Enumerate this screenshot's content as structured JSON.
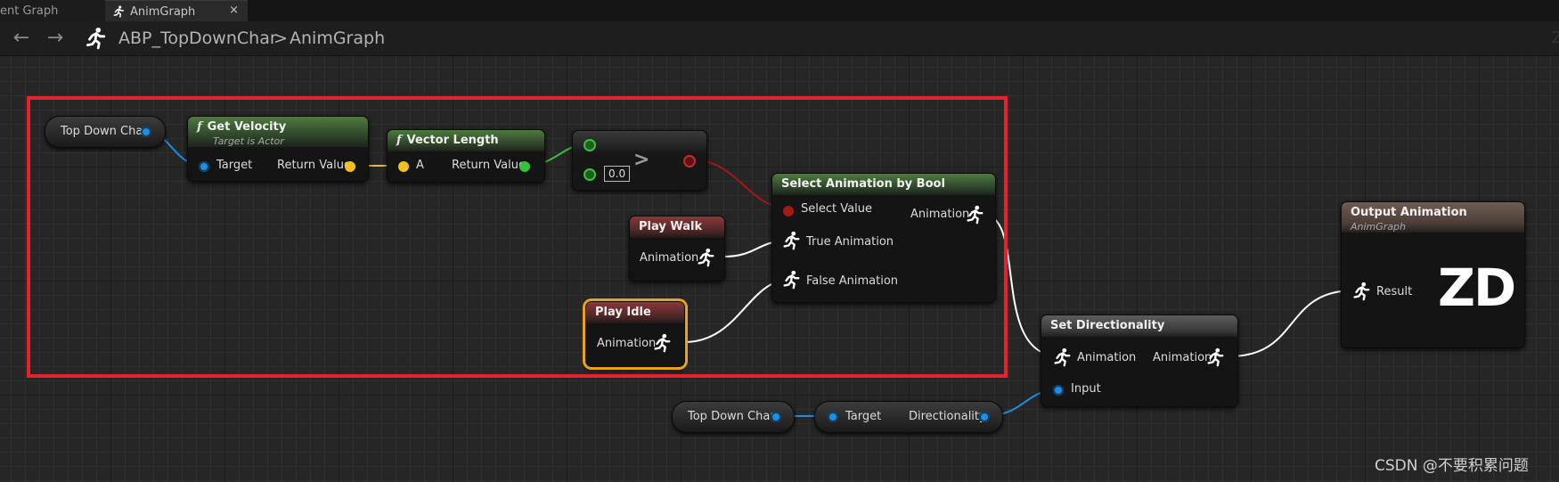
{
  "tabs": {
    "event_graph": "ent Graph",
    "anim_graph": "AnimGraph",
    "close": "×"
  },
  "breadcrumb": {
    "back": "←",
    "forward": "→",
    "blueprint": "ABP_TopDownChar",
    "separator": ">",
    "graph": "AnimGraph",
    "edge": "Z"
  },
  "nodes": {
    "top_down_char_1": {
      "label": "Top Down Char"
    },
    "get_velocity": {
      "title": "Get Velocity",
      "subtitle": "Target is Actor",
      "in_pin": "Target",
      "out_pin": "Return Value",
      "fn_icon": "f"
    },
    "vector_length": {
      "title": "Vector Length",
      "in_pin": "A",
      "out_pin": "Return Value",
      "fn_icon": "f"
    },
    "greater": {
      "symbol": ">",
      "const_value": "0.0"
    },
    "select_anim": {
      "title": "Select Animation by Bool",
      "select_pin": "Select Value",
      "true_pin": "True Animation",
      "false_pin": "False Animation",
      "out_pin": "Animation"
    },
    "play_walk": {
      "title": "Play Walk",
      "out_pin": "Animation"
    },
    "play_idle": {
      "title": "Play Idle",
      "out_pin": "Animation"
    },
    "set_directionality": {
      "title": "Set Directionality",
      "in_anim": "Animation",
      "out_anim": "Animation",
      "in_input": "Input"
    },
    "output_animation": {
      "title": "Output Animation",
      "subtitle": "AnimGraph",
      "in_pin": "Result",
      "logo": "ZD"
    },
    "top_down_char_2": {
      "label": "Top Down Char"
    },
    "directionality": {
      "in_pin": "Target",
      "out_pin": "Directionality"
    }
  },
  "colors": {
    "selection": "#e5232c",
    "object_pin": "#1e8fe0",
    "vector_pin": "#f0c020",
    "float_pin": "#39c13a",
    "bool_pin": "#a41818",
    "idle_highlight": "#e8a418"
  },
  "watermark": "CSDN @不要积累问题"
}
